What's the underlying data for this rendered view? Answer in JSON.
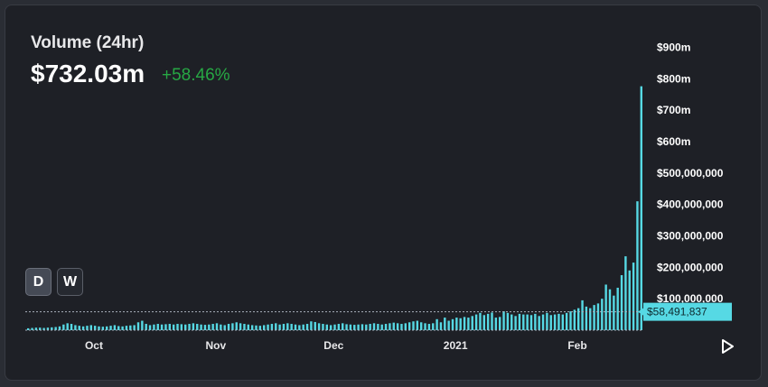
{
  "header": {
    "title": "Volume (24hr)",
    "value": "$732.03m",
    "change": "+58.46%"
  },
  "toggles": {
    "day_label": "D",
    "week_label": "W"
  },
  "colors": {
    "bar": "#56d9e4",
    "positive": "#27a844",
    "crosshair_label_bg": "#56d9e4",
    "crosshair_label_text": "#0d2a2e"
  },
  "icons": {
    "play": "play-icon"
  },
  "chart_data": {
    "type": "bar",
    "ylim": [
      0,
      950000000
    ],
    "y_ticks": [
      {
        "value": 100000000,
        "label": "$100,000,000"
      },
      {
        "value": 200000000,
        "label": "$200,000,000"
      },
      {
        "value": 300000000,
        "label": "$300,000,000"
      },
      {
        "value": 400000000,
        "label": "$400,000,000"
      },
      {
        "value": 500000000,
        "label": "$500,000,000"
      },
      {
        "value": 600000000,
        "label": "$600m"
      },
      {
        "value": 700000000,
        "label": "$700m"
      },
      {
        "value": 800000000,
        "label": "$800m"
      },
      {
        "value": 900000000,
        "label": "$900m"
      }
    ],
    "x_ticks": [
      {
        "index": 17,
        "label": "Oct"
      },
      {
        "index": 48,
        "label": "Nov"
      },
      {
        "index": 78,
        "label": "Dec"
      },
      {
        "index": 109,
        "label": "2021"
      },
      {
        "index": 140,
        "label": "Feb"
      }
    ],
    "crosshair": {
      "value": 58491837,
      "label": "$58,491,837"
    },
    "values": [
      6000000,
      7000000,
      8000000,
      8000000,
      7000000,
      8000000,
      9000000,
      10000000,
      12000000,
      18000000,
      22000000,
      20000000,
      16000000,
      14000000,
      12000000,
      14000000,
      16000000,
      14000000,
      12000000,
      11000000,
      12000000,
      14000000,
      16000000,
      13000000,
      12000000,
      14000000,
      15000000,
      16000000,
      25000000,
      30000000,
      20000000,
      16000000,
      18000000,
      20000000,
      18000000,
      19000000,
      20000000,
      18000000,
      20000000,
      19000000,
      18000000,
      20000000,
      22000000,
      20000000,
      18000000,
      17000000,
      18000000,
      20000000,
      22000000,
      18000000,
      16000000,
      20000000,
      22000000,
      25000000,
      22000000,
      20000000,
      18000000,
      16000000,
      15000000,
      14000000,
      16000000,
      18000000,
      20000000,
      22000000,
      18000000,
      20000000,
      22000000,
      20000000,
      18000000,
      16000000,
      18000000,
      20000000,
      28000000,
      26000000,
      22000000,
      20000000,
      18000000,
      16000000,
      18000000,
      20000000,
      22000000,
      19000000,
      18000000,
      17000000,
      18000000,
      19000000,
      18000000,
      20000000,
      22000000,
      20000000,
      18000000,
      20000000,
      22000000,
      24000000,
      22000000,
      20000000,
      22000000,
      25000000,
      28000000,
      30000000,
      25000000,
      22000000,
      20000000,
      22000000,
      35000000,
      25000000,
      40000000,
      30000000,
      35000000,
      40000000,
      38000000,
      42000000,
      40000000,
      45000000,
      50000000,
      55000000,
      48000000,
      52000000,
      56000000,
      40000000,
      42000000,
      60000000,
      55000000,
      50000000,
      45000000,
      52000000,
      50000000,
      50000000,
      48000000,
      52000000,
      45000000,
      50000000,
      55000000,
      48000000,
      50000000,
      52000000,
      50000000,
      55000000,
      60000000,
      65000000,
      70000000,
      95000000,
      75000000,
      70000000,
      80000000,
      85000000,
      100000000,
      145000000,
      130000000,
      110000000,
      135000000,
      175000000,
      235000000,
      190000000,
      215000000,
      410000000,
      776000000
    ]
  }
}
